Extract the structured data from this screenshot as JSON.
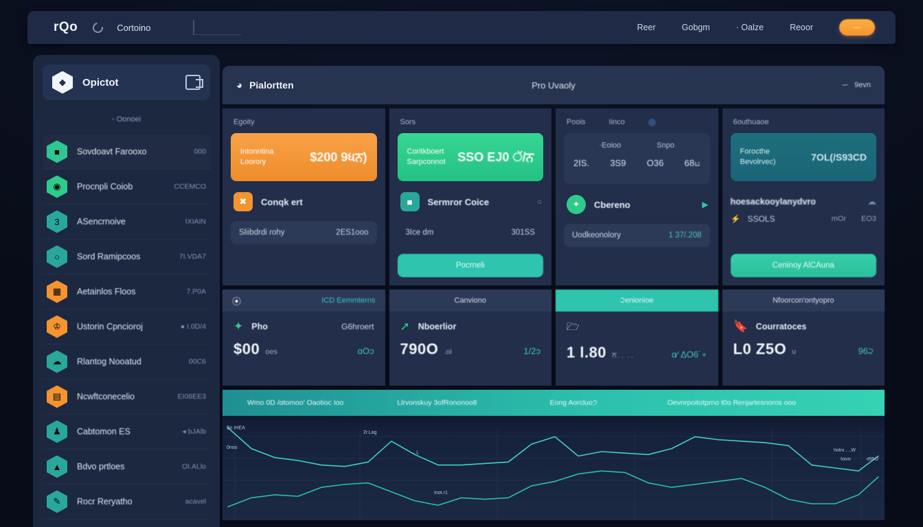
{
  "topbar": {
    "brand": "rQo",
    "spinner_icon": "spinner-icon",
    "label": "Cortoino",
    "search_placeholder": "",
    "nav": [
      {
        "label": "Reer"
      },
      {
        "label": "Gobgm"
      },
      {
        "label": "· Oalze"
      },
      {
        "label": "Reoor"
      }
    ],
    "cta_label": "—"
  },
  "sidebar": {
    "header": {
      "title": "Opictot",
      "logo_icon": "hex-logo-icon",
      "action_icon": "panel-toggle-icon"
    },
    "subtitle": "◦ Oonoei",
    "items": [
      {
        "label": "Sovdoavt Farooxo",
        "value": "000",
        "icon": "hex-stats-icon",
        "color": "#2ec792"
      },
      {
        "label": "Procnpli Coiob",
        "value": "CCEMCO",
        "icon": "hex-badge-icon",
        "color": "#2ecb8b"
      },
      {
        "label": "ASencrnoive",
        "value": "IXIAIN",
        "icon": "hex-three-icon",
        "color": "#2aa79b"
      },
      {
        "label": "Sord Ramipcoos",
        "value": "7I.VDA7",
        "icon": "hex-ring-icon",
        "color": "#2aa79b"
      },
      {
        "label": "Aetainlos Floos",
        "value": "7.P0A",
        "icon": "hex-book-icon",
        "color": "#f3942f"
      },
      {
        "label": "Ustorin Cpncioroj",
        "value": "● I.0D/4",
        "icon": "hex-crown-icon",
        "color": "#f3942f"
      },
      {
        "label": "Rlantog Nooatud",
        "value": "00C6",
        "icon": "hex-cloud-icon",
        "color": "#2aa79b"
      },
      {
        "label": "Ncwftconecelio",
        "value": "EI08EE3",
        "icon": "hex-chart-icon",
        "color": "#f3942f"
      },
      {
        "label": "Cabtomon ES",
        "value": "◂ bJAlb",
        "icon": "hex-person-icon",
        "color": "#2aa79b"
      },
      {
        "label": "Bdvo prtloes",
        "value": "OI.ALlo",
        "icon": "hex-rocket-icon",
        "color": "#2aa79b"
      },
      {
        "label": "Rocr Reryatho",
        "value": "acavel",
        "icon": "hex-edit-icon",
        "color": "#2aa79b"
      }
    ]
  },
  "main": {
    "header": {
      "icon": "dashboard-icon",
      "title": "Pialortten",
      "center_title": "Pro Uvaoly",
      "wave_icon": "wave-icon",
      "right_label": "9evn"
    },
    "cards_row1": [
      {
        "caption": "Egoity",
        "banner": {
          "label_line1": "Intonntina",
          "label_line2": "Loorory",
          "value": "$200 9ધਨ)",
          "style": "orange"
        },
        "item": {
          "label": "Conqk ert",
          "icon": "ticket-icon",
          "icon_color": "#f3942f"
        },
        "subrow": {
          "label": "Sliibdrdi rohy",
          "value": "2ES1ooo",
          "boxed": true
        }
      },
      {
        "caption": "Sors",
        "banner": {
          "label_line1": "Coritkboert",
          "label_line2": "Sarpconnot",
          "value": "SSO EJ0 ੱ/ਨ",
          "style": "green"
        },
        "item": {
          "label": "Sermror Coice",
          "icon": "shield-icon",
          "icon_color": "#2aa79b",
          "after": "○"
        },
        "subrow": {
          "label": "3Ice dm",
          "value": "301SS",
          "boxed": false
        },
        "cta": {
          "label": "Pocrneli"
        }
      },
      {
        "caption": "Poois",
        "caption2": "Iinco",
        "caption_badge": "badge-icon",
        "statgrid": {
          "top": [
            "·Eoioo",
            "Snpo"
          ],
          "row": [
            "2IS.",
            "3S9",
            "O36",
            "68ಟ"
          ]
        },
        "item": {
          "label": "Cbereno",
          "icon": "leaf-icon",
          "icon_color": "#2ecb8b",
          "after": "▶"
        },
        "subrow": {
          "label": "Uodkeonolory",
          "value": "1 37/.208",
          "boxed": true,
          "accent": true
        }
      },
      {
        "caption": "6outhuaoe",
        "banner": {
          "label_line1": "Forocthe",
          "label_line2": "Bevolrvec)",
          "value": "7OL(/S93CD",
          "style": "teal"
        },
        "title": "hoesackooylanydvro",
        "cloud_icon": "cloud-icon",
        "kv": {
          "bolt_icon": "bolt-icon",
          "value": "SSOLS",
          "right": [
            "mOr",
            "EO3"
          ]
        },
        "cta": {
          "label": "Ceninoy AlCAuna"
        }
      }
    ],
    "cards_row2": [
      {
        "header": {
          "lead_icon": "g-icon",
          "label": "ICD Eemmterns",
          "style": "mixed"
        },
        "icon": "leaf-icon",
        "name": "Pho",
        "tag": "G6hroert",
        "big": "$00",
        "small": "oes",
        "delta": "ɑOɔ"
      },
      {
        "header": {
          "label": "Canviono",
          "style": "dark"
        },
        "icon": "arrow-up-icon",
        "name": "Nboerlior",
        "tag": "",
        "big": "790O",
        "small": ".oi",
        "delta": "1/2ɔ"
      },
      {
        "header": {
          "label": "੨enionioe",
          "style": "tealbg"
        },
        "icon": "folder-icon",
        "name": "",
        "tag": "",
        "big": "1 l.80",
        "small": "ਨ․․ ․․",
        "delta": "ɑ⁄ ΔO6˙∘"
      },
      {
        "header": {
          "label": "Nfoorcon'ontyopro",
          "style": "dark"
        },
        "icon": "bookmark-icon",
        "name": "Courratoces",
        "tag": "",
        "big": "L0 Z5O",
        "small": "ʋ",
        "delta": "96੨"
      }
    ],
    "strip": [
      "Wmo 0D /ɑtomoo' Oaotioc Ioo",
      "Llrvonskuy  3ofRononoo8",
      "Eong Aorcluo੭",
      "Oevnrpoitotprno t0o Renjartesnoros ooo"
    ]
  },
  "chart_data": {
    "type": "line",
    "title": "",
    "xlabel": "",
    "ylabel": "",
    "grid": true,
    "legend_position": "none",
    "annotations": [
      {
        "text": "Bn IHEA",
        "x": 6,
        "y": 122
      },
      {
        "text": "0noo",
        "x": 6,
        "y": 96
      },
      {
        "text": "2r.Lag",
        "x": 205,
        "y": 116
      },
      {
        "text": "․ L",
        "x": 278,
        "y": 89
      },
      {
        "text": "Inot.r1",
        "x": 308,
        "y": 35
      },
      {
        "text": "hotni ․ ..W",
        "x": 890,
        "y": 92
      },
      {
        "text": "Ioivo",
        "x": 900,
        "y": 80
      },
      {
        "text": "d95O",
        "x": 938,
        "y": 80
      }
    ],
    "series": [
      {
        "name": "series-a",
        "color": "#3fd1c4",
        "x": [
          8,
          42,
          76,
          110,
          144,
          178,
          212,
          246,
          280,
          314,
          348,
          382,
          416,
          450,
          484,
          518,
          552,
          586,
          620,
          654,
          688,
          722,
          756,
          790,
          824,
          858,
          892,
          926,
          955
        ],
        "y": [
          124,
          96,
          84,
          80,
          74,
          72,
          78,
          106,
          88,
          74,
          74,
          76,
          78,
          102,
          112,
          86,
          92,
          90,
          88,
          96,
          112,
          108,
          106,
          104,
          100,
          74,
          70,
          66,
          86
        ]
      },
      {
        "name": "series-b",
        "color": "#2bbfa4",
        "x": [
          8,
          42,
          76,
          110,
          144,
          178,
          212,
          246,
          280,
          314,
          348,
          382,
          416,
          450,
          484,
          518,
          552,
          586,
          620,
          654,
          688,
          722,
          756,
          790,
          824,
          858,
          892,
          926,
          955
        ],
        "y": [
          18,
          30,
          34,
          32,
          44,
          48,
          50,
          38,
          26,
          20,
          30,
          28,
          30,
          46,
          52,
          62,
          66,
          64,
          50,
          44,
          48,
          52,
          56,
          44,
          28,
          22,
          22,
          34,
          58
        ]
      }
    ],
    "ylim": [
      0,
      140
    ],
    "xlim": [
      0,
      964
    ]
  }
}
